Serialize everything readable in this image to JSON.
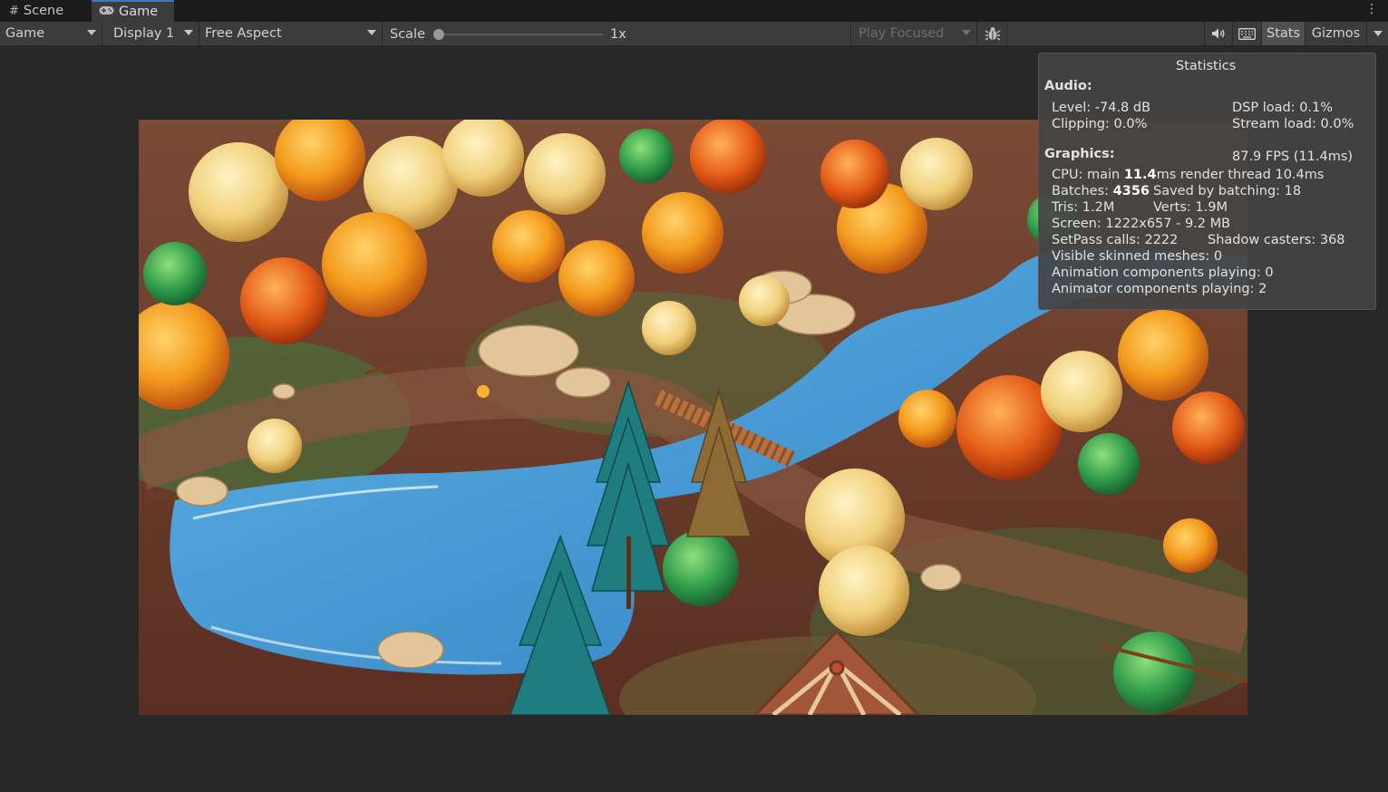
{
  "tabs": {
    "scene_label": "Scene",
    "game_label": "Game"
  },
  "toolbar": {
    "view_dropdown": "Game",
    "display_dropdown": "Display 1",
    "aspect_dropdown": "Free Aspect",
    "scale_label": "Scale",
    "scale_value": "1x",
    "play_mode_dropdown": "Play Focused",
    "stats_button": "Stats",
    "gizmos_button": "Gizmos"
  },
  "statistics": {
    "title": "Statistics",
    "audio_heading": "Audio:",
    "level": "Level: -74.8 dB",
    "dsp_load": "DSP load: 0.1%",
    "clipping": "Clipping: 0.0%",
    "stream_load": "Stream load: 0.0%",
    "graphics_heading": "Graphics:",
    "fps": "87.9 FPS (11.4ms)",
    "cpu_prefix": "CPU: main ",
    "cpu_main": "11.4",
    "cpu_suffix": "ms  render thread 10.4ms",
    "batches_prefix": "Batches: ",
    "batches": "4356",
    "saved_by_batching": "Saved by batching: 18",
    "tris": "Tris: 1.2M",
    "verts": "Verts: 1.9M",
    "screen": "Screen: 1222x657 - 9.2 MB",
    "setpass": "SetPass calls: 2222",
    "shadow_casters": "Shadow casters: 368",
    "skinned_meshes": "Visible skinned meshes: 0",
    "animation_components": "Animation components playing: 0",
    "animator_components": "Animator components playing: 2"
  },
  "colors": {
    "accent": "#3a79bb",
    "panel_bg": "#282828",
    "toolbar_bg": "#3c3c3c"
  },
  "icons": [
    "grid-icon",
    "gamepad-icon",
    "more-icon",
    "bug-icon",
    "audio-icon",
    "keyboard-icon"
  ]
}
